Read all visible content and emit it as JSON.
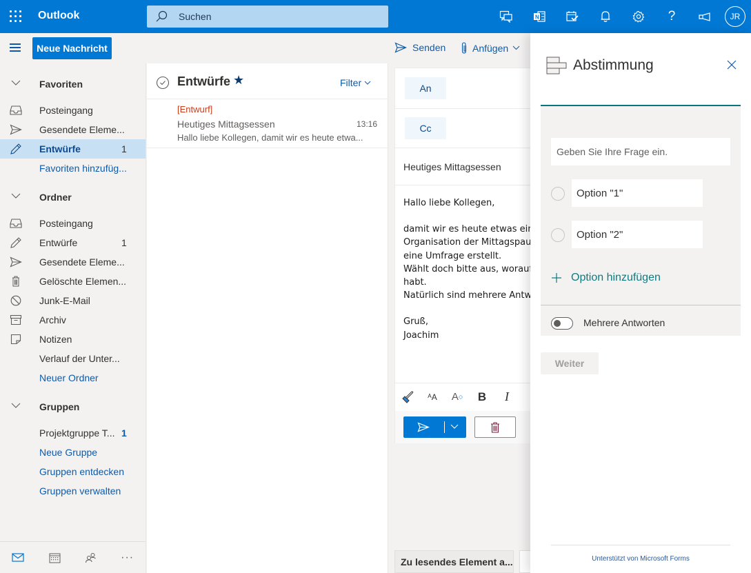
{
  "app": {
    "title": "Outlook",
    "search_placeholder": "Suchen",
    "avatar_initials": "JR",
    "top_icons": [
      "teams-chat-icon",
      "onenote-icon",
      "my-day-icon",
      "bell-icon",
      "gear-icon",
      "help-icon",
      "feedback-megaphone-icon"
    ]
  },
  "commandbar": {
    "new_message": "Neue Nachricht",
    "send": "Senden",
    "attach": "Anfügen"
  },
  "sidebar": {
    "favorites": {
      "header": "Favoriten",
      "items": [
        {
          "label": "Posteingang",
          "icon": "inbox-icon",
          "count": ""
        },
        {
          "label": "Gesendete Eleme...",
          "icon": "sent-icon",
          "count": ""
        },
        {
          "label": "Entwürfe",
          "icon": "pencil-icon",
          "count": "1",
          "active": true
        },
        {
          "label": "Favoriten hinzufüg...",
          "icon": "",
          "count": "",
          "link": true
        }
      ]
    },
    "folders": {
      "header": "Ordner",
      "items": [
        {
          "label": "Posteingang",
          "icon": "inbox-icon",
          "count": ""
        },
        {
          "label": "Entwürfe",
          "icon": "pencil-icon",
          "count": "1"
        },
        {
          "label": "Gesendete Eleme...",
          "icon": "sent-icon",
          "count": ""
        },
        {
          "label": "Gelöschte Elemen...",
          "icon": "trash-icon",
          "count": ""
        },
        {
          "label": "Junk-E-Mail",
          "icon": "block-icon",
          "count": ""
        },
        {
          "label": "Archiv",
          "icon": "archive-icon",
          "count": ""
        },
        {
          "label": "Notizen",
          "icon": "note-icon",
          "count": ""
        },
        {
          "label": "Verlauf der Unter...",
          "icon": "",
          "count": ""
        },
        {
          "label": "Neuer Ordner",
          "icon": "",
          "count": "",
          "link": true
        }
      ]
    },
    "groups": {
      "header": "Gruppen",
      "items": [
        {
          "label": "Projektgruppe T...",
          "count": "1"
        },
        {
          "label": "Neue Gruppe",
          "link": true
        },
        {
          "label": "Gruppen entdecken",
          "link": true
        },
        {
          "label": "Gruppen verwalten",
          "link": true
        }
      ]
    },
    "bottom_nav": [
      "mail-icon",
      "calendar-icon",
      "people-icon",
      "more-icon"
    ]
  },
  "message_list": {
    "title": "Entwürfe",
    "filter": "Filter",
    "items": [
      {
        "tag": "[Entwurf]",
        "subject": "Heutiges Mittagsessen",
        "time": "13:16",
        "preview": "Hallo liebe Kollegen, damit wir es heute etwa..."
      }
    ]
  },
  "compose": {
    "to_label": "An",
    "cc_label": "Cc",
    "subject": "Heutiges Mittagsessen",
    "body_lines": [
      "Hallo liebe Kollegen,",
      "",
      "damit wir es heute etwas ein",
      "Organisation der Mittagspau",
      "eine Umfrage erstellt.",
      "Wählt doch bitte aus, worauf",
      "habt.",
      "Natürlich sind mehrere Antw",
      "",
      "Gruß,",
      "Joachim"
    ],
    "reading_pane_button": "Zu lesendes Element a..."
  },
  "poll_panel": {
    "title": "Abstimmung",
    "question_placeholder": "Geben Sie Ihre Frage ein.",
    "options": [
      "Option \"1\"",
      "Option \"2\""
    ],
    "add_option": "Option hinzufügen",
    "multiple_answers_label": "Mehrere Antworten",
    "multiple_answers_enabled": false,
    "next_button": "Weiter",
    "footer": "Unterstützt von Microsoft Forms",
    "accent_color": "#03787c"
  }
}
